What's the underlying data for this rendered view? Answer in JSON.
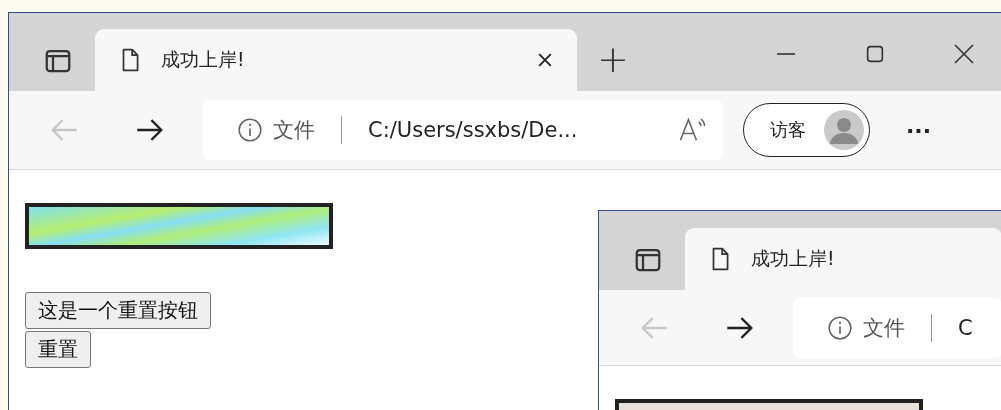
{
  "windows": [
    {
      "tab": {
        "title": "成功上岸!",
        "selected": true,
        "closable": true
      },
      "new_tab": "+",
      "controls": true,
      "back": {
        "disabled": true
      },
      "forward": {
        "disabled": false
      },
      "address": {
        "scheme": "文件",
        "url": "C:/Users/ssxbs/De..."
      },
      "profile": {
        "label": "访客"
      },
      "more": "···",
      "page": {
        "kind": "form",
        "buttons": [
          "这是一个重置按钮",
          "重置"
        ]
      }
    },
    {
      "tab": {
        "title": "成功上岸!",
        "selected": true,
        "closable": false
      },
      "controls": false,
      "back": {
        "disabled": true
      },
      "forward": {
        "disabled": false
      },
      "address": {
        "scheme": "文件",
        "url": "C"
      },
      "page": {
        "kind": "image"
      }
    }
  ]
}
